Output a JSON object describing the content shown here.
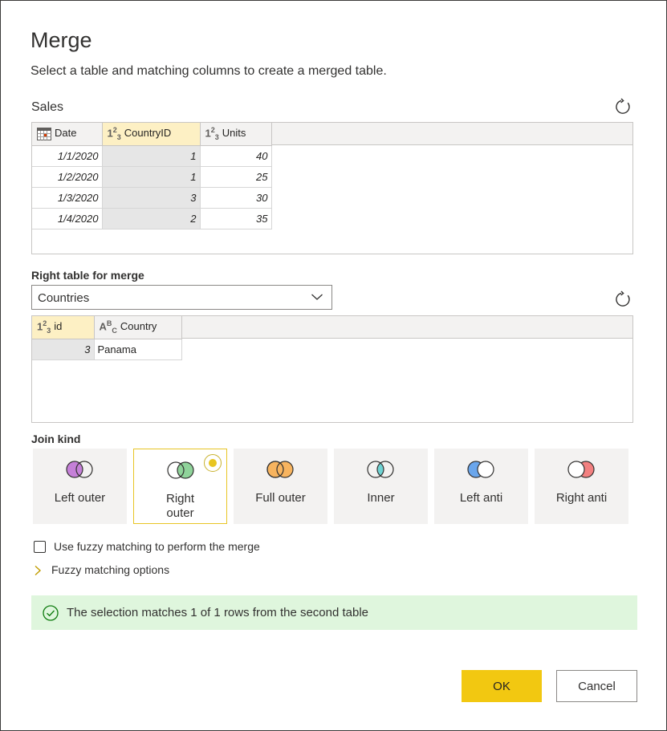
{
  "dialog": {
    "title": "Merge",
    "subtitle": "Select a table and matching columns to create a merged table."
  },
  "first_table": {
    "name": "Sales",
    "columns": [
      {
        "label": "Date",
        "icon": "calendar-icon",
        "selected": false
      },
      {
        "label": "CountryID",
        "icon": "number-type-icon",
        "selected": true
      },
      {
        "label": "Units",
        "icon": "number-type-icon",
        "selected": false
      }
    ],
    "rows": [
      [
        "1/1/2020",
        "1",
        "40"
      ],
      [
        "1/2/2020",
        "1",
        "25"
      ],
      [
        "1/3/2020",
        "3",
        "30"
      ],
      [
        "1/4/2020",
        "2",
        "35"
      ]
    ]
  },
  "second_table": {
    "label": "Right table for merge",
    "selected": "Countries",
    "columns": [
      {
        "label": "id",
        "icon": "number-type-icon",
        "selected": true
      },
      {
        "label": "Country",
        "icon": "text-type-icon",
        "selected": false
      }
    ],
    "rows": [
      [
        "3",
        "Panama"
      ]
    ]
  },
  "join_kind": {
    "label": "Join kind",
    "selected": "Right outer",
    "options": [
      {
        "label": "Left outer",
        "color": "#c580d8"
      },
      {
        "label": "Right outer",
        "color": "#8fd39a"
      },
      {
        "label": "Full outer",
        "color": "#f7b45f"
      },
      {
        "label": "Inner",
        "color": "#6fd3d3"
      },
      {
        "label": "Left anti",
        "color": "#6aa6ec"
      },
      {
        "label": "Right anti",
        "color": "#f28080"
      }
    ]
  },
  "fuzzy": {
    "checkbox_label": "Use fuzzy matching to perform the merge",
    "checked": false,
    "options_label": "Fuzzy matching options"
  },
  "status": {
    "message": "The selection matches 1 of 1 rows from the second table",
    "color": "#dff6dd"
  },
  "buttons": {
    "ok": "OK",
    "cancel": "Cancel"
  },
  "colors": {
    "accent": "#f2c811",
    "selected_header": "#fdf0c4"
  }
}
